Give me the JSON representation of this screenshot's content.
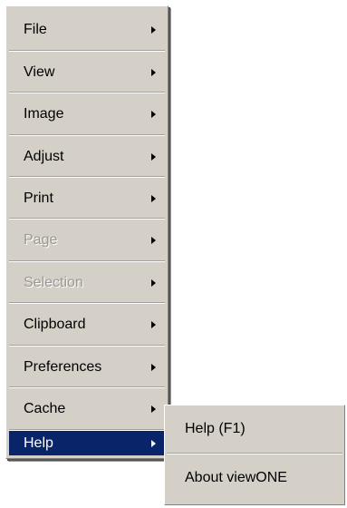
{
  "menu": {
    "items": [
      {
        "label": "File",
        "disabled": false,
        "active": false,
        "has_submenu": true
      },
      {
        "label": "View",
        "disabled": false,
        "active": false,
        "has_submenu": true
      },
      {
        "label": "Image",
        "disabled": false,
        "active": false,
        "has_submenu": true
      },
      {
        "label": "Adjust",
        "disabled": false,
        "active": false,
        "has_submenu": true
      },
      {
        "label": "Print",
        "disabled": false,
        "active": false,
        "has_submenu": true
      },
      {
        "label": "Page",
        "disabled": true,
        "active": false,
        "has_submenu": true
      },
      {
        "label": "Selection",
        "disabled": true,
        "active": false,
        "has_submenu": true
      },
      {
        "label": "Clipboard",
        "disabled": false,
        "active": false,
        "has_submenu": true
      },
      {
        "label": "Preferences",
        "disabled": false,
        "active": false,
        "has_submenu": true
      },
      {
        "label": "Cache",
        "disabled": false,
        "active": false,
        "has_submenu": true
      },
      {
        "label": "Help",
        "disabled": false,
        "active": true,
        "has_submenu": true
      }
    ]
  },
  "submenu": {
    "items": [
      {
        "label": "Help (F1)"
      },
      {
        "label": "About viewONE"
      }
    ]
  },
  "colors": {
    "menu_background": "#d4d0c8",
    "highlight": "#0a246a",
    "disabled_text": "#9a9890"
  },
  "icons": {
    "submenu_arrow": "chevron-right-icon"
  }
}
